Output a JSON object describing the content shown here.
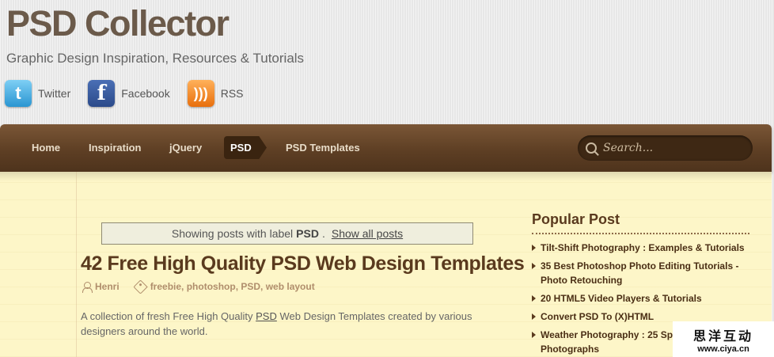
{
  "header": {
    "title": "PSD Collector",
    "tagline": "Graphic Design Inspiration, Resources & Tutorials",
    "social": [
      {
        "label": "Twitter",
        "icon": "twitter-icon",
        "glyph": "t"
      },
      {
        "label": "Facebook",
        "icon": "facebook-icon",
        "glyph": "f"
      },
      {
        "label": "RSS",
        "icon": "rss-icon",
        "glyph": ")))"
      }
    ]
  },
  "nav": {
    "items": [
      "Home",
      "Inspiration",
      "jQuery",
      "PSD",
      "PSD Templates"
    ],
    "active": "PSD",
    "search_placeholder": "Search..."
  },
  "banner": {
    "prefix": "Showing posts with label",
    "label": "PSD",
    "suffix": ".",
    "show_all": "Show all posts"
  },
  "post": {
    "title": "42 Free High Quality PSD Web Design Templates",
    "author": "Henri",
    "tags": "freebie, photoshop, PSD, web layout",
    "excerpt_before": "A collection of fresh Free High Quality",
    "excerpt_link": "PSD",
    "excerpt_after": "Web Design Templates created by various designers around the world."
  },
  "sidebar": {
    "title": "Popular Post",
    "items": [
      "Tilt-Shift Photography : Examples & Tutorials",
      "35 Best Photoshop Photo Editing Tutorials - Photo Retouching",
      "20 HTML5 Video Players & Tutorials",
      "Convert PSD To (X)HTML",
      "Weather Photography : 25 Spectacular Photographs"
    ]
  },
  "watermark": {
    "cn": "思洋互动",
    "url": "www.ciya.cn"
  },
  "colors": {
    "nav_bg": "#5e3f24",
    "content_bg": "#fdf6c8",
    "title_brown": "#5a3a1e",
    "meta_tan": "#b08e6c"
  }
}
